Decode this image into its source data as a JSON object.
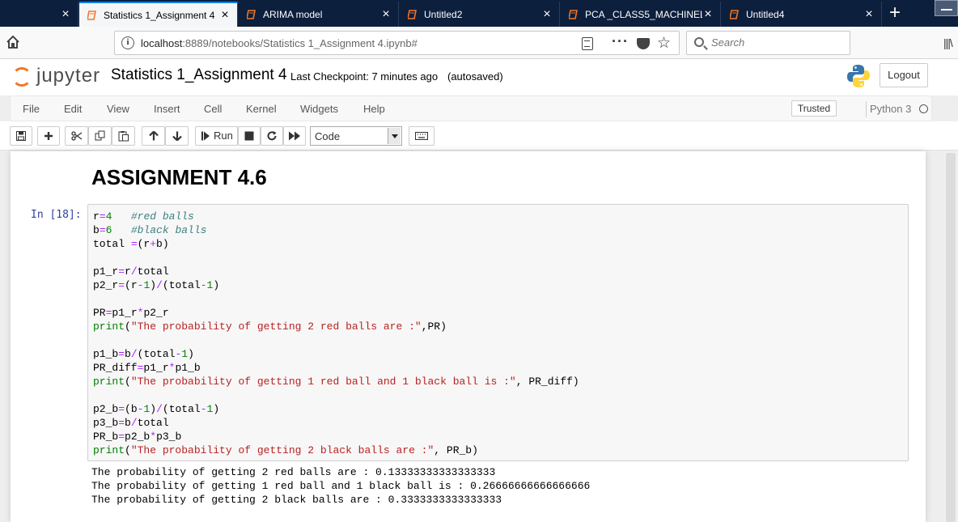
{
  "browser": {
    "tabs": [
      {
        "label": "",
        "active": false
      },
      {
        "label": "Statistics 1_Assignment 4",
        "active": true
      },
      {
        "label": "ARIMA model",
        "active": false
      },
      {
        "label": "Untitled2",
        "active": false
      },
      {
        "label": "PCA _CLASS5_MACHINELI",
        "active": false
      },
      {
        "label": "Untitled4",
        "active": false
      }
    ],
    "url_host": "localhost",
    "url_path": ":8889/notebooks/Statistics 1_Assignment 4.ipynb#",
    "search_placeholder": "Search",
    "tab_accent": "#0a84ff",
    "tab_icon_color": "#f37626"
  },
  "jupyter": {
    "logo_text": "jupyter",
    "notebook_title": "Statistics 1_Assignment 4",
    "checkpoint": "Last Checkpoint: 7 minutes ago",
    "autosave": "(autosaved)",
    "logout_label": "Logout",
    "menu": [
      "File",
      "Edit",
      "View",
      "Insert",
      "Cell",
      "Kernel",
      "Widgets",
      "Help"
    ],
    "trusted_label": "Trusted",
    "kernel_name": "Python 3",
    "toolbar": {
      "run_label": "Run",
      "cell_type": "Code"
    }
  },
  "notebook": {
    "heading": "ASSIGNMENT 4.6",
    "cell_prompt": "In [18]:",
    "output_lines": [
      "The probability of getting 2 red balls are : 0.13333333333333333",
      "The probability of getting 1 red ball and 1 black ball is : 0.26666666666666666",
      "The probability of getting 2 black balls are : 0.3333333333333333"
    ]
  }
}
